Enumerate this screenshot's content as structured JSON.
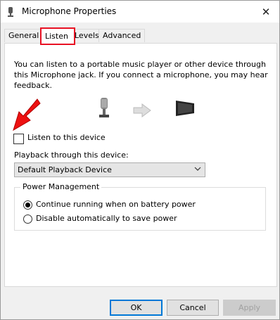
{
  "window": {
    "title": "Microphone Properties",
    "close_glyph": "✕"
  },
  "tabs": [
    {
      "label": "General",
      "selected": false
    },
    {
      "label": "Listen",
      "selected": true
    },
    {
      "label": "Levels",
      "selected": false
    },
    {
      "label": "Advanced",
      "selected": false
    }
  ],
  "listen": {
    "description": "You can listen to a portable music player or other device through this Microphone jack.  If you connect a microphone, you may hear feedback.",
    "listen_checkbox_label": "Listen to this device",
    "listen_checked": false,
    "playback_label": "Playback through this device:",
    "playback_value": "Default Playback Device"
  },
  "power": {
    "legend": "Power Management",
    "option1": "Continue running when on battery power",
    "option2": "Disable automatically to save power",
    "selected": 1
  },
  "buttons": {
    "ok": "OK",
    "cancel": "Cancel",
    "apply": "Apply"
  },
  "colors": {
    "highlight_red": "#e81123",
    "focus_blue": "#0078d7"
  }
}
